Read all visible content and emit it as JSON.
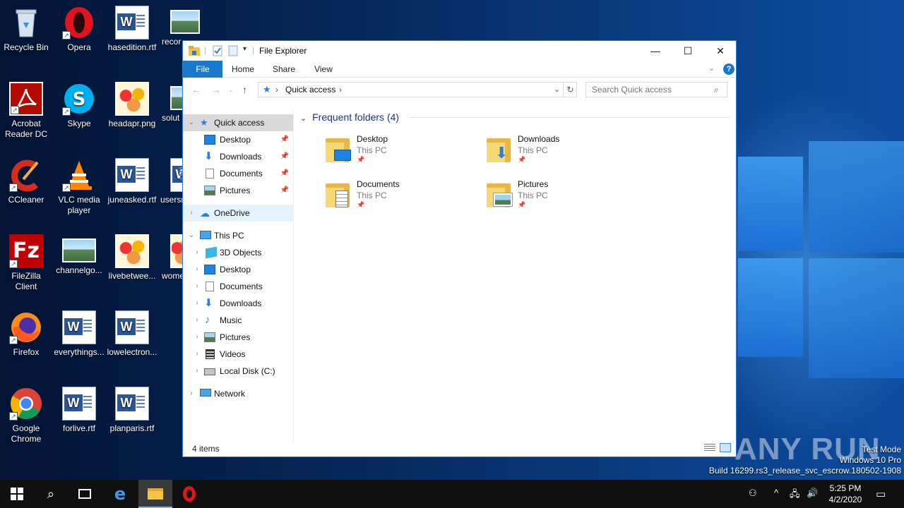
{
  "desktop": {
    "icons": [
      {
        "label": "Recycle Bin"
      },
      {
        "label": "Opera"
      },
      {
        "label": "hasedition.rtf"
      },
      {
        "label": "recor"
      },
      {
        "label": "Acrobat Reader DC"
      },
      {
        "label": "Skype"
      },
      {
        "label": "headapr.png"
      },
      {
        "label": "solut"
      },
      {
        "label": "CCleaner"
      },
      {
        "label": "VLC media player"
      },
      {
        "label": "juneasked.rtf"
      },
      {
        "label": "usersr"
      },
      {
        "label": "FileZilla Client"
      },
      {
        "label": "channelgo..."
      },
      {
        "label": "livebetwee..."
      },
      {
        "label": "wome"
      },
      {
        "label": "Firefox"
      },
      {
        "label": "everythings..."
      },
      {
        "label": "lowelectron..."
      },
      {
        "label": "Google Chrome"
      },
      {
        "label": "forlive.rtf"
      },
      {
        "label": "planparis.rtf"
      }
    ]
  },
  "window": {
    "title": "File Explorer",
    "controls": {
      "minimize": "—",
      "maximize": "☐",
      "close": "✕"
    },
    "ribbon_tabs": [
      "File",
      "Home",
      "Share",
      "View"
    ],
    "help": "?",
    "address": {
      "location": "Quick access",
      "sep1": "›",
      "sep2": "›"
    },
    "search_placeholder": "Search Quick access",
    "nav": {
      "quick_access": "Quick access",
      "qa_items": [
        "Desktop",
        "Downloads",
        "Documents",
        "Pictures"
      ],
      "onedrive": "OneDrive",
      "this_pc": "This PC",
      "pc_items": [
        "3D Objects",
        "Desktop",
        "Documents",
        "Downloads",
        "Music",
        "Pictures",
        "Videos",
        "Local Disk (C:)"
      ],
      "network": "Network"
    },
    "content": {
      "group_header": "Frequent folders (4)",
      "folders": [
        {
          "name": "Desktop",
          "location": "This PC"
        },
        {
          "name": "Downloads",
          "location": "This PC"
        },
        {
          "name": "Documents",
          "location": "This PC"
        },
        {
          "name": "Pictures",
          "location": "This PC"
        }
      ]
    },
    "status": {
      "count": "4 items"
    }
  },
  "watermark": {
    "line1": "Test Mode",
    "line2": "Windows 10 Pro",
    "line3": "Build 16299.rs3_release_svc_escrow.180502-1908",
    "brand": "ANY RUN"
  },
  "taskbar": {
    "time": "5:25 PM",
    "date": "4/2/2020"
  },
  "colors": {
    "accent": "#1979ca",
    "taskbar": "#101010",
    "folder": "#f8d775"
  }
}
